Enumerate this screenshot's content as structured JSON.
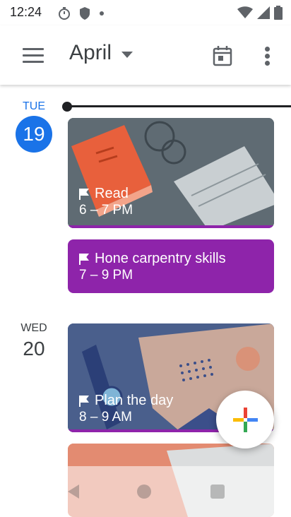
{
  "status": {
    "time": "12:24"
  },
  "header": {
    "month": "April"
  },
  "days": [
    {
      "weekday": "TUE",
      "date": "19"
    },
    {
      "weekday": "WED",
      "date": "20"
    }
  ],
  "events": [
    {
      "title": "Read",
      "time": "6 – 7 PM"
    },
    {
      "title": "Hone carpentry skills",
      "time": "7 – 9 PM"
    },
    {
      "title": "Plan the day",
      "time": "8 – 9 AM"
    }
  ],
  "colors": {
    "accent": "#1a73e8",
    "event_purple": "#8e24aa"
  }
}
